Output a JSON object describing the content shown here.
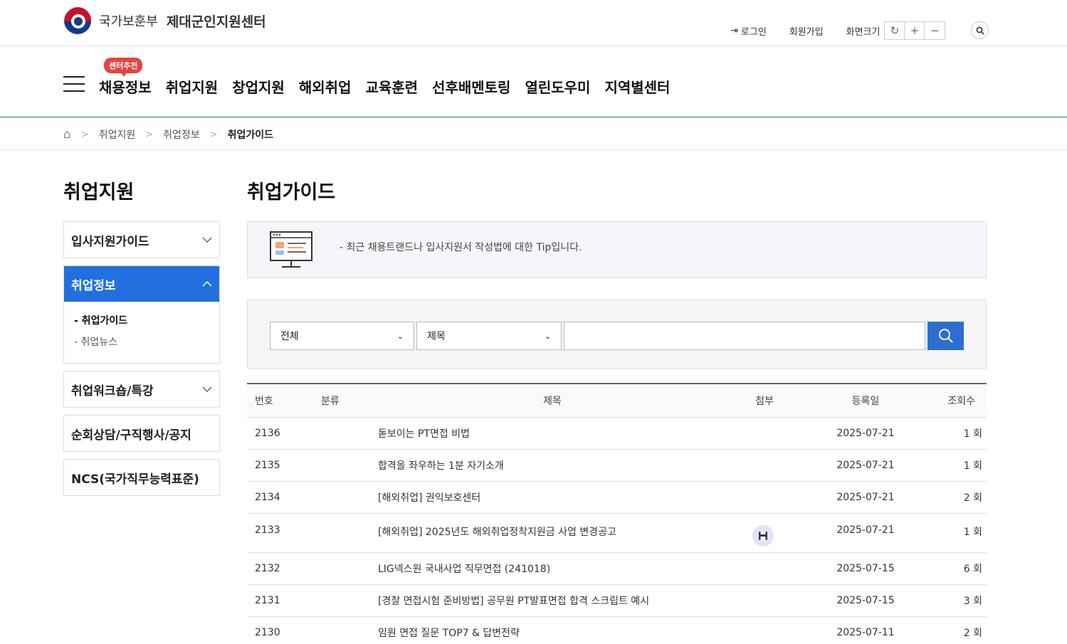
{
  "header": {
    "ministry": "국가보훈부",
    "center": "제대군인지원센터",
    "login": "로그인",
    "join": "회원가입",
    "font_size": "화면크기",
    "font_reset": "↻",
    "font_plus": "+",
    "font_minus": "−",
    "search_icon": "search-icon"
  },
  "gnb": {
    "badge": "센터추천",
    "items": [
      "채용정보",
      "취업지원",
      "창업지원",
      "해외취업",
      "교육훈련",
      "선후배멘토링",
      "열린도우미",
      "지역별센터"
    ]
  },
  "breadcrumb": {
    "items": [
      "취업지원",
      "취업정보",
      "취업가이드"
    ]
  },
  "lnb": {
    "title": "취업지원",
    "items": [
      {
        "label": "입사지원가이드"
      },
      {
        "label": "취업정보",
        "active": true
      },
      {
        "label": "취업워크숍/특강"
      },
      {
        "label": "순회상담/구직행사/공지"
      },
      {
        "label": "NCS(국가직무능력표준)"
      }
    ],
    "subs": [
      "- 취업가이드",
      "- 취업뉴스"
    ]
  },
  "content": {
    "title": "취업가이드",
    "info": "-  최근 채용트랜드나 입사지원서 작성법에 대한 Tip입니다.",
    "search": {
      "category": "전체",
      "field": "제목",
      "keyword": ""
    }
  },
  "table": {
    "headers": {
      "no": "번호",
      "category": "분류",
      "title": "제목",
      "file": "첨부",
      "date": "등록일",
      "views": "조회수"
    },
    "rows": [
      {
        "no": "2136",
        "category": "",
        "title": "돋보이는 PT면접 비법",
        "file": false,
        "date": "2025-07-21",
        "views": "1 회"
      },
      {
        "no": "2135",
        "category": "",
        "title": "합격을 좌우하는 1분 자기소개",
        "file": false,
        "date": "2025-07-21",
        "views": "1 회"
      },
      {
        "no": "2134",
        "category": "",
        "title": "[해외취업] 권익보호센터",
        "file": false,
        "date": "2025-07-21",
        "views": "2 회"
      },
      {
        "no": "2133",
        "category": "",
        "title": "[해외취업] 2025년도 해외취업정착지원금 사업 변경공고",
        "file": true,
        "date": "2025-07-21",
        "views": "1 회"
      },
      {
        "no": "2132",
        "category": "",
        "title": "LIG넥스원 국내사업 직무면접 (241018)",
        "file": false,
        "date": "2025-07-15",
        "views": "6 회"
      },
      {
        "no": "2131",
        "category": "",
        "title": "[경찰 면접시험 준비방법] 공무원 PT발표면접 합격 스크립트 예시",
        "file": false,
        "date": "2025-07-15",
        "views": "3 회"
      },
      {
        "no": "2130",
        "category": "",
        "title": "임원 면접 질문 TOP7 & 답변전략",
        "file": false,
        "date": "2025-07-11",
        "views": "2 회"
      }
    ]
  },
  "colors": {
    "primary": "#2270e0",
    "search_button": "#2c6fd1",
    "badge": "#e8423f"
  }
}
